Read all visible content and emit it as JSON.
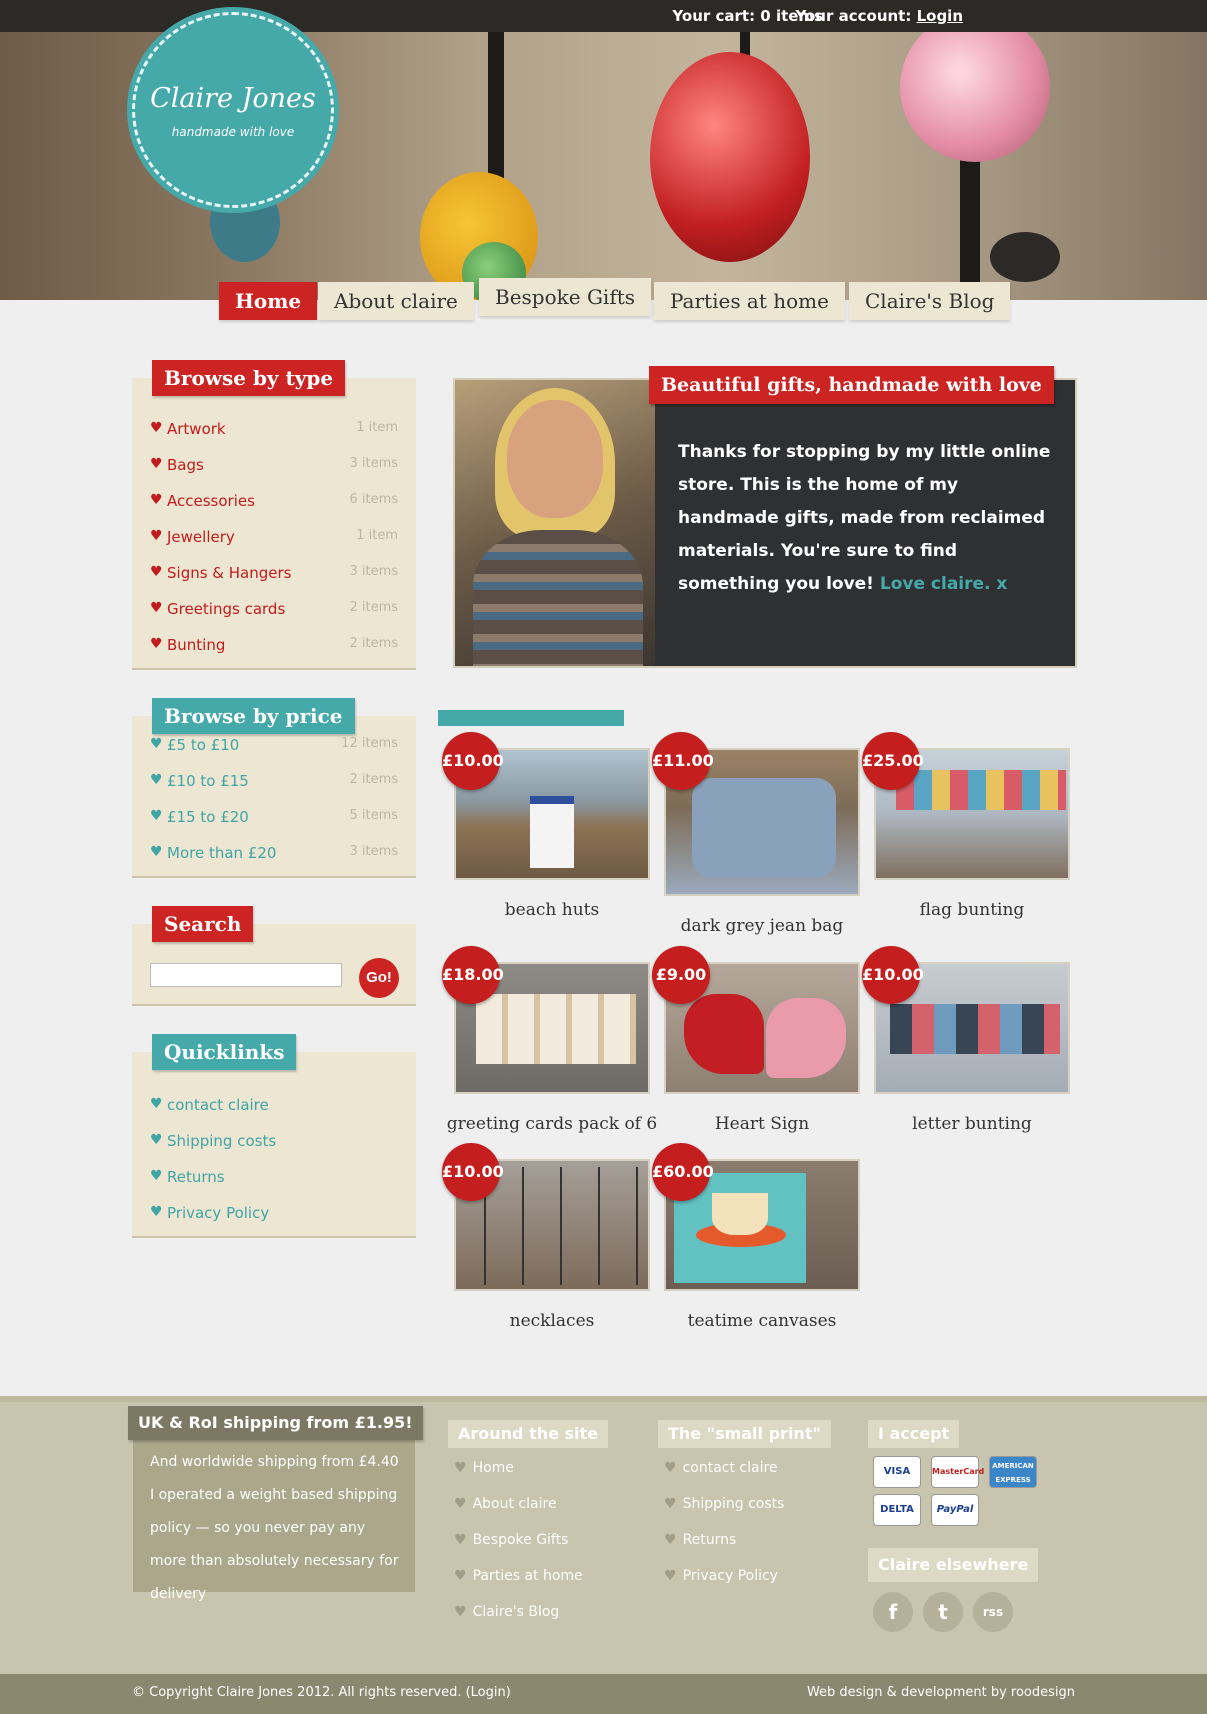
{
  "topbar": {
    "cart_label": "Your cart: 0 items",
    "account_label": "Your account:",
    "login_label": "Login"
  },
  "logo": {
    "name": "Claire Jones",
    "tagline": "handmade with love"
  },
  "nav": [
    {
      "label": "Home"
    },
    {
      "label": "About claire"
    },
    {
      "label": "Bespoke Gifts"
    },
    {
      "label": "Parties at home"
    },
    {
      "label": "Claire's Blog"
    }
  ],
  "browse_type": {
    "title": "Browse by type",
    "items": [
      {
        "label": "Artwork",
        "count": "1 item"
      },
      {
        "label": "Bags",
        "count": "3 items"
      },
      {
        "label": "Accessories",
        "count": "6 items"
      },
      {
        "label": "Jewellery",
        "count": "1 item"
      },
      {
        "label": "Signs & Hangers",
        "count": "3 items"
      },
      {
        "label": "Greetings cards",
        "count": "2 items"
      },
      {
        "label": "Bunting",
        "count": "2 items"
      }
    ]
  },
  "browse_price": {
    "title": "Browse by price",
    "items": [
      {
        "label": "£5 to £10",
        "count": "12 items"
      },
      {
        "label": "£10 to £15",
        "count": "2 items"
      },
      {
        "label": "£15 to £20",
        "count": "5 items"
      },
      {
        "label": "More than £20",
        "count": "3 items"
      }
    ]
  },
  "search": {
    "title": "Search",
    "placeholder": "",
    "button": "Go!"
  },
  "quicklinks": {
    "title": "Quicklinks",
    "items": [
      {
        "label": "contact claire"
      },
      {
        "label": "Shipping costs"
      },
      {
        "label": "Returns"
      },
      {
        "label": "Privacy Policy"
      }
    ]
  },
  "feature": {
    "title": "Beautiful gifts, handmade with love",
    "text": "Thanks for stopping by my little online store. This is the home of my handmade gifts, made from reclaimed materials. You're sure to find something you love!",
    "signature": "Love claire. x"
  },
  "products": [
    {
      "price": "£10.00",
      "name": "beach huts"
    },
    {
      "price": "£11.00",
      "name": "dark grey jean bag"
    },
    {
      "price": "£25.00",
      "name": "flag bunting"
    },
    {
      "price": "£18.00",
      "name": "greeting cards pack of 6"
    },
    {
      "price": "£9.00",
      "name": "Heart Sign"
    },
    {
      "price": "£10.00",
      "name": "letter bunting"
    },
    {
      "price": "£10.00",
      "name": "necklaces"
    },
    {
      "price": "£60.00",
      "name": "teatime canvases"
    }
  ],
  "footer": {
    "ship_title": "UK & RoI shipping from £1.95!",
    "ship_text": "And worldwide shipping from £4.40 I operated a weight based shipping policy — so you never pay any more than absolutely necessary for delivery",
    "around_title": "Around the site",
    "around_items": [
      {
        "label": "Home"
      },
      {
        "label": "About claire"
      },
      {
        "label": "Bespoke Gifts"
      },
      {
        "label": "Parties at home"
      },
      {
        "label": "Claire's Blog"
      }
    ],
    "small_title": "The \"small print\"",
    "small_items": [
      {
        "label": "contact claire"
      },
      {
        "label": "Shipping costs"
      },
      {
        "label": "Returns"
      },
      {
        "label": "Privacy Policy"
      }
    ],
    "accept_title": "I accept",
    "cards": [
      {
        "label": "VISA"
      },
      {
        "label": "MasterCard"
      },
      {
        "label": "AMERICAN EXPRESS"
      },
      {
        "label": "DELTA"
      },
      {
        "label": "PayPal"
      }
    ],
    "elsewhere_title": "Claire elsewhere",
    "social": [
      {
        "label": "f",
        "icon": "facebook-icon"
      },
      {
        "label": "t",
        "icon": "twitter-icon"
      },
      {
        "label": "rss",
        "icon": "rss-icon"
      }
    ],
    "copyright": "© Copyright Claire Jones 2012. All rights reserved. (Login)",
    "credit": "Web design & development by roodesign"
  }
}
